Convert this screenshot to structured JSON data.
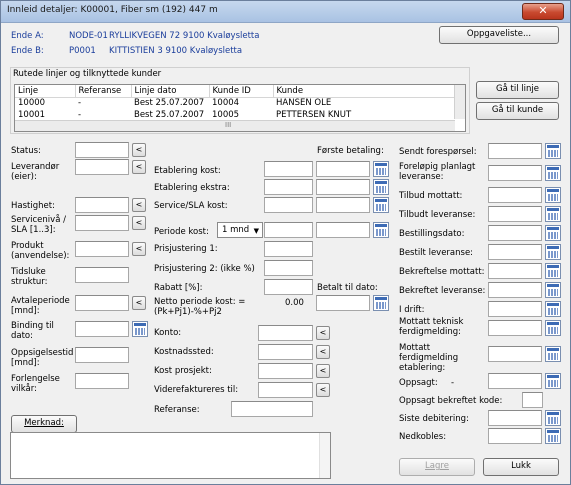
{
  "window": {
    "title": "Innleid detaljer: K00001, Fiber sm (192) 447 m",
    "close_glyph": "✕"
  },
  "endpoints": {
    "a_label": "Ende A:",
    "a_code": "NODE-01",
    "a_address": "RYLLIKVEGEN 72 9100 Kvaløysletta",
    "b_label": "Ende B:",
    "b_code": "P0001",
    "b_address": "KITTISTIEN 3 9100 Kvaløysletta"
  },
  "buttons": {
    "tasklist": "Oppgaveliste...",
    "goto_line": "Gå til linje",
    "goto_customer": "Gå til kunde",
    "remark": "Merknad:",
    "save": "Lagre",
    "close": "Lukk",
    "picker": "<"
  },
  "lines_group": {
    "title": "Rutede linjer og tilknyttede kunder",
    "columns": [
      "Linje",
      "Referanse",
      "Linje dato",
      "Kunde ID",
      "Kunde"
    ],
    "rows": [
      [
        "10000",
        "-",
        "Best 25.07.2007",
        "10004",
        "HANSEN OLE"
      ],
      [
        "10001",
        "-",
        "Best 25.07.2007",
        "10005",
        "PETTERSEN KNUT"
      ]
    ],
    "scroll_thumb": "III"
  },
  "left_fields": {
    "status": "Status:",
    "supplier": "Leverandør (eier):",
    "speed": "Hastighet:",
    "service_level": "Servicenivå / SLA [1..3]:",
    "product": "Produkt (anvendelse):",
    "time_limited": "Tidsluke struktur:",
    "contract_period": "Avtaleperiode [mnd]:",
    "binding": "Binding til dato:",
    "termination": "Oppsigelsestid [mnd]:",
    "extension": "Forlengelse vilkår:"
  },
  "middle_fields": {
    "first_payment": "Første betaling:",
    "establishment_cost": "Etablering kost:",
    "establishment_extra": "Etablering ekstra:",
    "service_cost": "Service/SLA kost:",
    "period_cost": "Periode kost:",
    "period_value": "1 mnd",
    "price_adj1": "Prisjustering 1:",
    "price_adj2": "Prisjustering 2: (ikke %)",
    "discount": "Rabatt [%]:",
    "net_period_cost": "Netto periode kost: =(Pk+Pj1)-%+Pj2",
    "net_value": "0.00",
    "paid_until": "Betalt til dato:",
    "account": "Konto:",
    "cost_center": "Kostnadssted:",
    "cost_project": "Kost prosjekt:",
    "reinvoiced_to": "Viderefaktureres til:",
    "reference": "Referanse:"
  },
  "right_fields": {
    "sent_request": "Sendt forespørsel:",
    "planned_delivery": "Foreløpig planlagt leveranse:",
    "offer_received": "Tilbud mottatt:",
    "offer_delivery": "Tilbudt leveranse:",
    "order_date": "Bestillingsdato:",
    "ordered_delivery": "Bestilt leveranse:",
    "confirmation_received": "Bekreftelse mottatt:",
    "confirmed_delivery": "Bekreftet leveranse:",
    "in_service": "I drift:",
    "tech_done": "Mottatt teknisk ferdigmelding:",
    "establishment_done": "Mottatt ferdigmelding etablering:",
    "terminated": "Oppsagt:",
    "terminated_dash": "-",
    "termination_code": "Oppsagt bekreftet kode:",
    "last_billing": "Siste debitering:",
    "disconnected": "Nedkobles:"
  }
}
